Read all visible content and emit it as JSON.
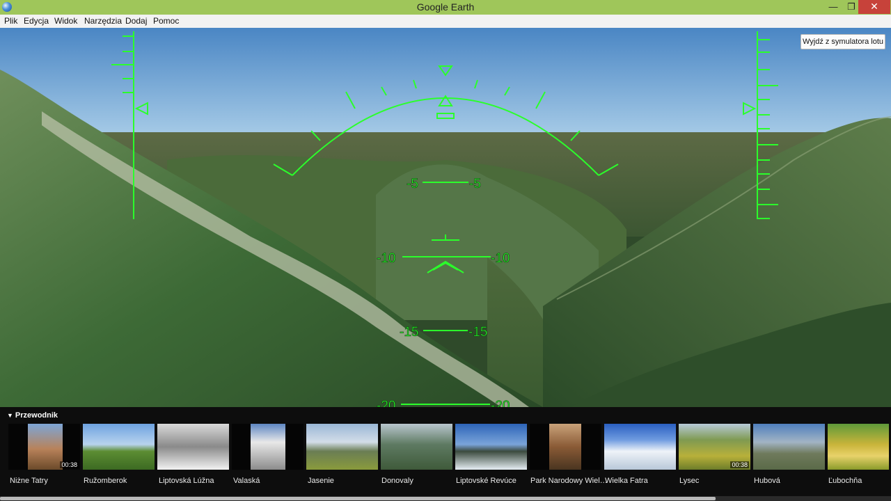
{
  "window": {
    "title": "Google Earth",
    "minimize": "—",
    "maximize": "❐",
    "close": "✕"
  },
  "menu": [
    "Plik",
    "Edycja",
    "Widok",
    "Narzędzia",
    "Dodaj",
    "Pomoc"
  ],
  "simulator": {
    "exit_label": "Wyjdź z symulatora lotu",
    "pitch_labels": [
      "-5",
      "-10",
      "-15",
      "-20"
    ]
  },
  "guide": {
    "header": "Przewodnik",
    "items": [
      {
        "label": "Niżne Tatry",
        "duration": "00:38"
      },
      {
        "label": "Ružomberok",
        "duration": ""
      },
      {
        "label": "Liptovská Lúžna",
        "duration": ""
      },
      {
        "label": "Valaská",
        "duration": ""
      },
      {
        "label": "Jasenie",
        "duration": ""
      },
      {
        "label": "Donovaly",
        "duration": ""
      },
      {
        "label": "Liptovské Revúce",
        "duration": ""
      },
      {
        "label": "Park Narodowy Wiel…",
        "duration": ""
      },
      {
        "label": "Wielka Fatra",
        "duration": ""
      },
      {
        "label": "Lysec",
        "duration": "00:38"
      },
      {
        "label": "Hubová",
        "duration": ""
      },
      {
        "label": "Ľubochňa",
        "duration": ""
      }
    ]
  },
  "colors": {
    "titlebar": "#9fc65a",
    "hud": "#2bff2b",
    "close_button": "#c7423a"
  }
}
